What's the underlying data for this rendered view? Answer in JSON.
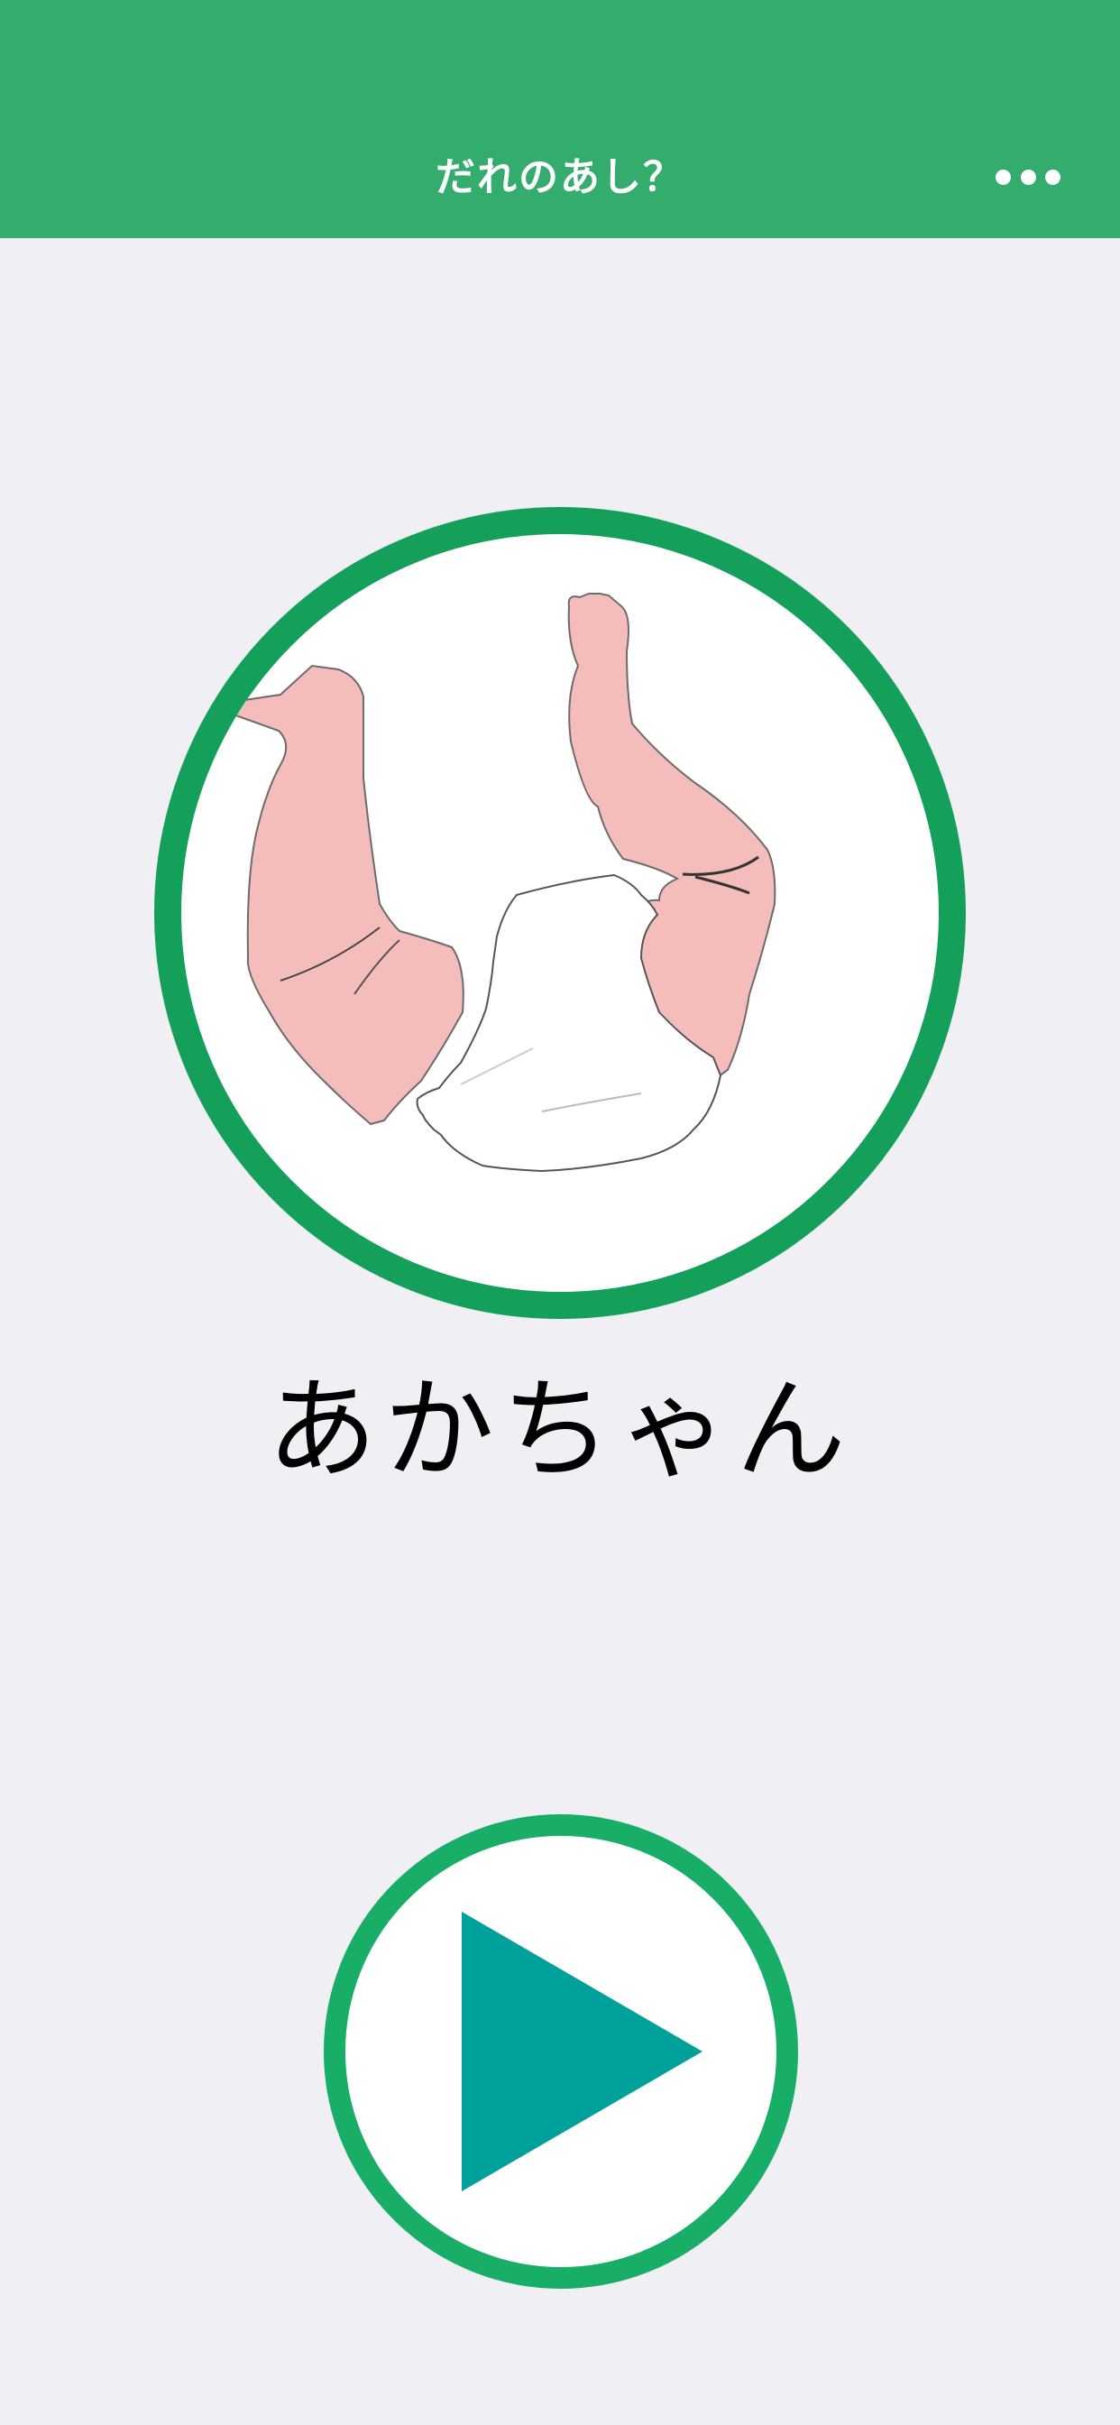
{
  "header": {
    "title": "だれのあし？",
    "more_icon": "ellipsis-icon"
  },
  "main": {
    "picture_icon": "baby-legs-illustration",
    "answer_label": "あかちゃん",
    "play_icon": "play-triangle-icon"
  },
  "colors": {
    "nav_background": "#33AC6E",
    "frame_ring": "#14A05A",
    "play_ring": "#19AE68",
    "play_triangle": "#00A19A",
    "skin": "#F4BDBB",
    "page_background": "#EFEFF4"
  }
}
